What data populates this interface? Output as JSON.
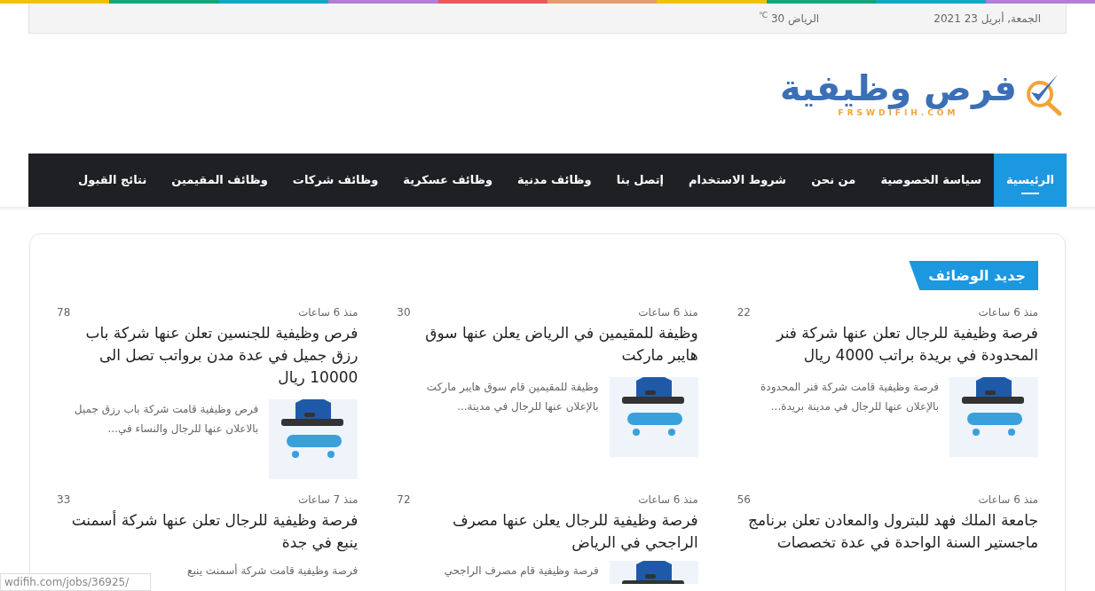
{
  "top_bar": {
    "date": "الجمعة, أبريل 23 2021",
    "weather": {
      "city": "الرياض",
      "temperature": "30",
      "unit": "℃"
    }
  },
  "logo": {
    "name": "فرص وظيفية",
    "domain": "FRSWDIFIH.COM"
  },
  "nav": {
    "items": [
      {
        "label": "الرئيسية",
        "selected": true
      },
      {
        "label": "سياسة الخصوصية",
        "selected": false
      },
      {
        "label": "من نحن",
        "selected": false
      },
      {
        "label": "شروط الاستخدام",
        "selected": false
      },
      {
        "label": "إتصل بنا",
        "selected": false
      },
      {
        "label": "وظائف مدنية",
        "selected": false
      },
      {
        "label": "وظائف عسكرية",
        "selected": false
      },
      {
        "label": "وظائف شركات",
        "selected": false
      },
      {
        "label": "وظائف المقيمين",
        "selected": false
      },
      {
        "label": "نتائج القبول",
        "selected": false
      }
    ]
  },
  "section": {
    "title": "جديد الوضائف"
  },
  "posts": [
    {
      "time": "منذ 6 ساعات",
      "views": "22",
      "title": "فرصة وظيفية للرجال تعلن عنها شركة فنر المحدودة في بريدة براتب 4000 ريال",
      "excerpt": "فرصة وظيفية قامت شركة فنر المحدودة بالإعلان عنها للرجال في مدينة بريدة..."
    },
    {
      "time": "منذ 6 ساعات",
      "views": "30",
      "title": "وظيفة للمقيمين في الرياض يعلن عنها سوق هايبر ماركت",
      "excerpt": "وظيفة للمقيمين قام سوق هايبر ماركت بالإعلان عنها للرجال في مدينة..."
    },
    {
      "time": "منذ 6 ساعات",
      "views": "78",
      "title": "فرص وظيفية للجنسين تعلن عنها شركة باب رزق جميل في عدة مدن برواتب تصل الى 10000 ريال",
      "excerpt": "فرص وظيفية قامت شركة باب رزق جميل بالاعلان عنها للرجال والنساء في..."
    },
    {
      "time": "منذ 6 ساعات",
      "views": "56",
      "title": "جامعة الملك فهد للبترول والمعادن تعلن برنامج ماجستير السنة الواحدة في عدة تخصصات"
    },
    {
      "time": "منذ 6 ساعات",
      "views": "72",
      "title": "فرصة وظيفية للرجال يعلن عنها مصرف الراجحي في الرياض",
      "excerpt": "فرصة وظيفية قام مصرف الراجحي"
    },
    {
      "time": "منذ 7 ساعات",
      "views": "33",
      "title": "فرصة وظيفية للرجال تعلن عنها شركة أسمنت ينبع في جدة",
      "excerpt": "فرصة وظيفية قامت شركة أسمنت ينبع"
    }
  ],
  "status_url": "wdifih.com/jobs/36925/"
}
